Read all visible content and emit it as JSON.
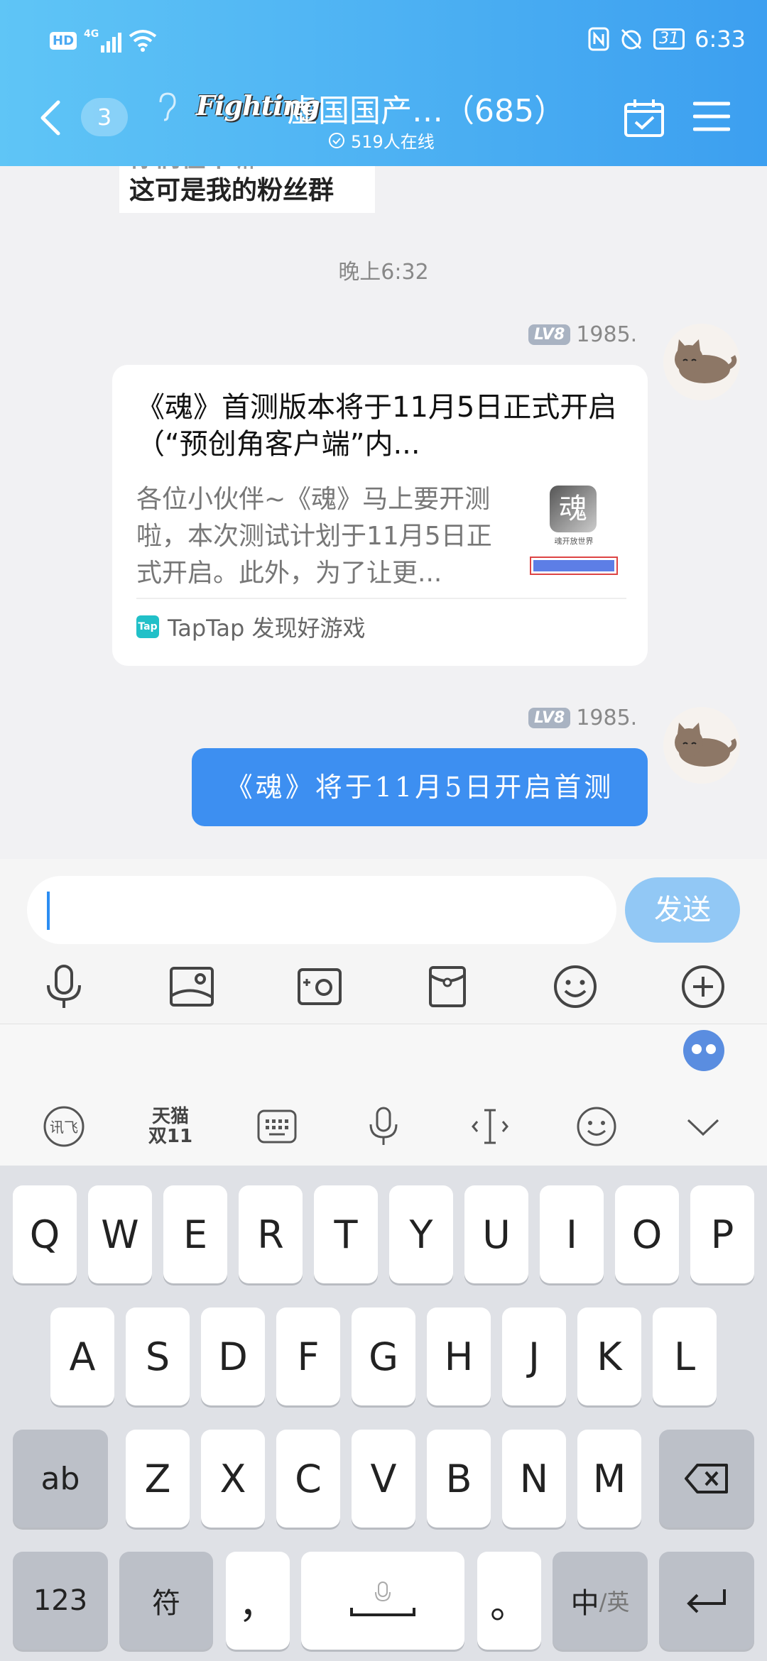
{
  "status": {
    "hd": "HD",
    "net": "4G",
    "battery": "31",
    "time": "6:33"
  },
  "header": {
    "unread": "3",
    "logo": "Fighting",
    "title": "虚国国产…（685）",
    "online": "519人在线"
  },
  "chat": {
    "img_text_top": "你们在干嘛",
    "img_text": "这可是我的粉丝群",
    "time": "晚上6:32",
    "msg1": {
      "level": "LV8",
      "name": "1985.",
      "title": "《魂》首测版本将于11月5日正式开启（“预创角客户端”内...",
      "body": "各位小伙伴~《魂》马上要开测啦，本次测试计划于11月5日正式开启。此外，为了让更...",
      "thumb_caption": "魂开放世界",
      "source": "TapTap 发现好游戏"
    },
    "msg2": {
      "level": "LV8",
      "name": "1985.",
      "text": "《魂》将于11月5日开启首测"
    }
  },
  "input": {
    "placeholder": "",
    "send": "发送"
  },
  "ime": {
    "tmall": "天猫\n双11"
  },
  "keyboard": {
    "row1": [
      "Q",
      "W",
      "E",
      "R",
      "T",
      "Y",
      "U",
      "I",
      "O",
      "P"
    ],
    "row2": [
      "A",
      "S",
      "D",
      "F",
      "G",
      "H",
      "J",
      "K",
      "L"
    ],
    "row3": [
      "Z",
      "X",
      "C",
      "V",
      "B",
      "N",
      "M"
    ],
    "ab": "ab",
    "num": "123",
    "sym": "符",
    "comma": "，",
    "period": "。",
    "lang_zh": "中",
    "lang_en": "/英"
  }
}
